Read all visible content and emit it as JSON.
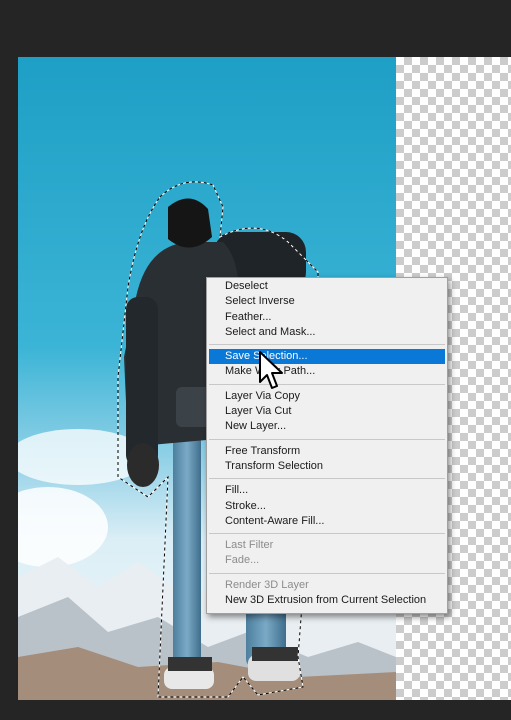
{
  "context_menu": {
    "groups": [
      [
        {
          "label": "Deselect"
        },
        {
          "label": "Select Inverse"
        },
        {
          "label": "Feather..."
        },
        {
          "label": "Select and Mask..."
        }
      ],
      [
        {
          "label": "Save Selection...",
          "highlighted": true
        },
        {
          "label": "Make Work Path..."
        }
      ],
      [
        {
          "label": "Layer Via Copy"
        },
        {
          "label": "Layer Via Cut"
        },
        {
          "label": "New Layer..."
        }
      ],
      [
        {
          "label": "Free Transform"
        },
        {
          "label": "Transform Selection"
        }
      ],
      [
        {
          "label": "Fill..."
        },
        {
          "label": "Stroke..."
        },
        {
          "label": "Content-Aware Fill..."
        }
      ],
      [
        {
          "label": "Last Filter",
          "disabled": true
        },
        {
          "label": "Fade...",
          "disabled": true
        }
      ],
      [
        {
          "label": "Render 3D Layer",
          "disabled": true
        },
        {
          "label": "New 3D Extrusion from Current Selection"
        }
      ]
    ]
  },
  "colors": {
    "menu_highlight": "#0a78d7",
    "menu_background": "#f0f0f0",
    "sky_top": "#1a9fc4",
    "canvas_background": "#252525"
  },
  "icons": {
    "cursor": "arrow-pointer-icon"
  }
}
